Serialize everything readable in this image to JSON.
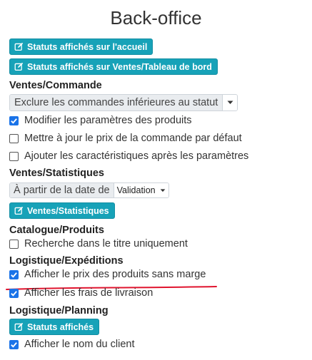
{
  "page": {
    "title": "Back-office"
  },
  "buttons": {
    "statuts_accueil": "Statuts affichés sur l'accueil",
    "statuts_ventes": "Statuts affichés sur Ventes/Tableau de bord",
    "ventes_statistiques": "Ventes/Statistiques",
    "statuts_affiches": "Statuts affichés"
  },
  "sections": {
    "ventes_commande": "Ventes/Commande",
    "ventes_statistiques": "Ventes/Statistiques",
    "catalogue_produits": "Catalogue/Produits",
    "logistique_expeditions": "Logistique/Expéditions",
    "logistique_planning": "Logistique/Planning"
  },
  "ventes_commande": {
    "select_value": "Exclure les commandes inférieures au statut",
    "options": [
      {
        "label": "Modifier les paramètres des produits",
        "checked": true
      },
      {
        "label": "Mettre à jour le prix de la commande par défaut",
        "checked": false
      },
      {
        "label": "Ajouter les caractéristiques après les paramètres",
        "checked": false
      }
    ]
  },
  "ventes_statistiques": {
    "date_label": "À partir de la date de",
    "date_select": "Validation"
  },
  "catalogue_produits": {
    "options": [
      {
        "label": "Recherche dans le titre uniquement",
        "checked": false
      }
    ]
  },
  "logistique_expeditions": {
    "options": [
      {
        "label": "Afficher le prix des produits sans marge",
        "checked": true
      },
      {
        "label": "Afficher les frais de livraison",
        "checked": true
      }
    ]
  },
  "logistique_planning": {
    "options": [
      {
        "label": "Afficher le nom du client",
        "checked": true
      }
    ]
  },
  "colors": {
    "button": "#17a2b8",
    "checkbox": "#1a73e8",
    "annotation_underline": "#e0142e"
  },
  "icons": {
    "button_icon": "edit-icon",
    "checkbox_mark": "check-icon",
    "select_arrow": "caret-down-icon"
  }
}
